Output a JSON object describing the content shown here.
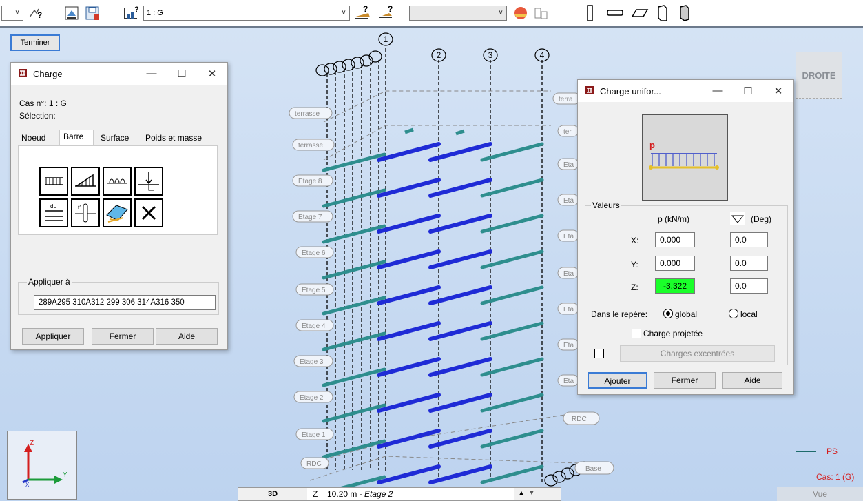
{
  "toolbar": {
    "case_combo": "1 : G",
    "view_button": "3D",
    "z_level": "Z = 10.20 m",
    "z_story": " - Etage 2"
  },
  "viewport": {
    "finish_button": "Terminer",
    "view_cube": "DROITE",
    "axis_labels": [
      "1",
      "2",
      "3",
      "4"
    ],
    "storey_labels": [
      "terrasse",
      "terrasse",
      "Etage 8",
      "Etage 7",
      "Etage 6",
      "Etage 5",
      "Etage 4",
      "Etage 3",
      "Etage 2",
      "Etage 1",
      "RDC"
    ],
    "right_labels": [
      "terra",
      "ter",
      "Eta",
      "Eta",
      "Eta",
      "Eta",
      "Eta",
      "Eta",
      "Eta",
      "Eta",
      "RDC",
      "Base"
    ],
    "legend_label": "PS",
    "case_label": "Cas: 1 (G)",
    "view_label": "Vue",
    "colors": {
      "selected_bar": "#1f2bd6",
      "bar": "#2e8e8e",
      "background": "#c8daf2"
    }
  },
  "charge_window": {
    "title": "Charge",
    "case_text": "Cas n°: 1 : G",
    "selection_text": "Sélection:",
    "tabs": [
      "Noeud",
      "Barre",
      "Surface",
      "Poids et masse"
    ],
    "active_tab": "Barre",
    "tools": [
      "uniform-load-icon",
      "trapezoidal-load-icon",
      "moment-load-icon",
      "point-load-icon",
      "dilatation-load-icon",
      "thermal-load-icon",
      "surface-load-icon",
      "delete-icon"
    ],
    "apply_to_label": "Appliquer à",
    "apply_to_value": "289A295 310A312 299 306 314A316 350",
    "buttons": {
      "apply": "Appliquer",
      "close": "Fermer",
      "help": "Aide"
    }
  },
  "uniform_window": {
    "title": "Charge unifor...",
    "diagram_label": "p",
    "group_label": "Valeurs",
    "col_p": "p  (kN/m)",
    "col_deg": "(Deg)",
    "rows": [
      {
        "axis": "X:",
        "p": "0.000",
        "deg": "0.0"
      },
      {
        "axis": "Y:",
        "p": "0.000",
        "deg": "0.0"
      },
      {
        "axis": "Z:",
        "p": "-3.322",
        "deg": "0.0"
      }
    ],
    "frame_label": "Dans le repère:",
    "frame_global": "global",
    "frame_local": "local",
    "projected_label": "Charge projetée",
    "eccentric_button": "Charges excentrées",
    "buttons": {
      "add": "Ajouter",
      "close": "Fermer",
      "help": "Aide"
    }
  }
}
